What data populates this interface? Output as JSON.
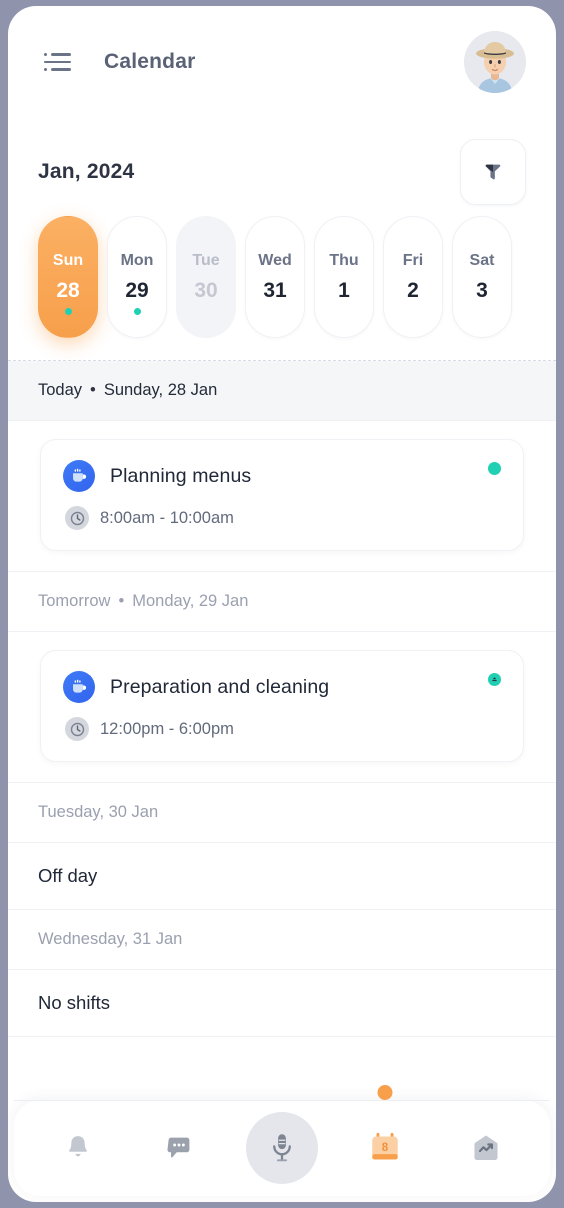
{
  "app": {
    "title": "Calendar",
    "menu_icon": "hamburger-list-icon",
    "avatar_alt": "user-avatar"
  },
  "month": {
    "label": "Jan, 2024",
    "filter_icon": "filter-funnel-icon"
  },
  "week": {
    "days": [
      {
        "dow": "Sun",
        "num": "28",
        "state": "selected",
        "has_dot": true
      },
      {
        "dow": "Mon",
        "num": "29",
        "state": "default",
        "has_dot": true
      },
      {
        "dow": "Tue",
        "num": "30",
        "state": "muted",
        "has_dot": false
      },
      {
        "dow": "Wed",
        "num": "31",
        "state": "default",
        "has_dot": false
      },
      {
        "dow": "Thu",
        "num": "1",
        "state": "default",
        "has_dot": false
      },
      {
        "dow": "Fri",
        "num": "2",
        "state": "default",
        "has_dot": false
      },
      {
        "dow": "Sat",
        "num": "3",
        "state": "default",
        "has_dot": false
      }
    ]
  },
  "agenda": {
    "sections": [
      {
        "prefix": "Today",
        "bullet": "•",
        "date": "Sunday, 28 Jan",
        "highlight": true,
        "dim": false,
        "event": {
          "icon": "coffee-mug-icon",
          "title": "Planning menus",
          "time_icon": "clock-icon",
          "time": "8:00am - 10:00am",
          "status_dot": "status-dot-teal",
          "status_marker": false
        }
      },
      {
        "prefix": "Tomorrow",
        "bullet": "•",
        "date": "Monday, 29 Jan",
        "highlight": false,
        "dim": true,
        "event": {
          "icon": "coffee-mug-icon",
          "title": "Preparation and cleaning",
          "time_icon": "clock-icon",
          "time": "12:00pm - 6:00pm",
          "status_dot": "status-dot-teal",
          "status_marker": true
        }
      },
      {
        "prefix": "",
        "bullet": "",
        "date": "Tuesday, 30 Jan",
        "highlight": false,
        "dim": true,
        "plain": "Off day"
      },
      {
        "prefix": "",
        "bullet": "",
        "date": "Wednesday, 31 Jan",
        "highlight": false,
        "dim": true,
        "plain": "No shifts"
      }
    ]
  },
  "bottom_nav": {
    "items": [
      {
        "name": "bell-icon",
        "active": false,
        "badge": false
      },
      {
        "name": "chat-bubble-icon",
        "active": false,
        "badge": false
      },
      {
        "name": "microphone-icon",
        "active": false,
        "badge": false
      },
      {
        "name": "calendar-icon",
        "active": true,
        "badge": true,
        "day_number": "8"
      },
      {
        "name": "trending-up-icon",
        "active": false,
        "badge": false
      }
    ]
  },
  "colors": {
    "accent_orange": "#f79f4b",
    "status_teal": "#21d0b2",
    "event_blue": "#3264ee",
    "text_dark": "#212838",
    "text_muted": "#9aa0af",
    "frame": "#8f93ab"
  }
}
